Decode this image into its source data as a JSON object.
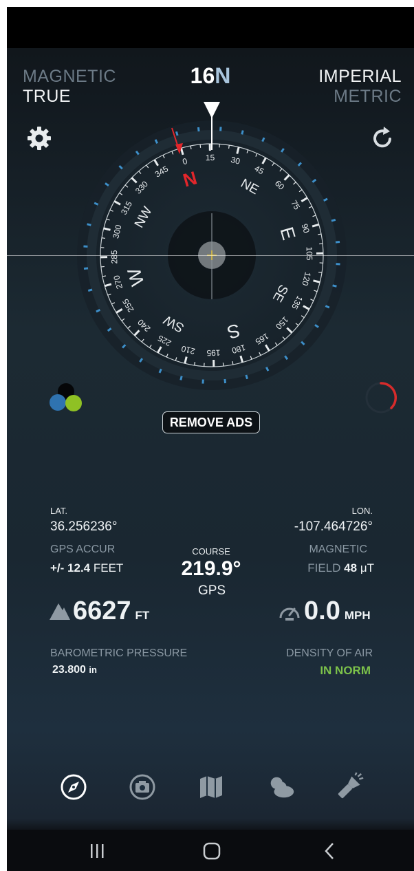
{
  "modes": {
    "north_magnetic": "MAGNETIC",
    "north_true": "TRUE",
    "units_imperial": "IMPERIAL",
    "units_metric": "METRIC"
  },
  "heading": {
    "degrees": "16",
    "direction": "N"
  },
  "compass": {
    "cardinals": [
      "N",
      "NE",
      "E",
      "SE",
      "S",
      "SW",
      "W",
      "NW"
    ],
    "degree_labels": [
      "0",
      "15",
      "30",
      "45",
      "60",
      "75",
      "90",
      "105",
      "120",
      "135",
      "150",
      "165",
      "180",
      "195",
      "210",
      "225",
      "240",
      "255",
      "270",
      "285",
      "300",
      "315",
      "330",
      "345"
    ],
    "rotation_deg": -16
  },
  "ads": {
    "remove_label": "REMOVE ADS"
  },
  "location": {
    "lat_label": "LAT.",
    "lat_value": "36.256236°",
    "lon_label": "LON.",
    "lon_value": "-107.464726°"
  },
  "gps": {
    "accuracy_label": "GPS ACCUR",
    "accuracy_prefix": "+/-",
    "accuracy_value": "12.4",
    "accuracy_unit": "FEET"
  },
  "course": {
    "label": "COURSE",
    "value": "219.9°",
    "source": "GPS"
  },
  "magnetic": {
    "label": "MAGNETIC",
    "field_label": "FIELD",
    "field_value": "48",
    "field_unit": "μT"
  },
  "altitude": {
    "value": "6627",
    "unit": "FT"
  },
  "speed": {
    "value": "0.0",
    "unit": "MPH"
  },
  "pressure": {
    "label": "BAROMETRIC PRESSURE",
    "value": "23.800",
    "unit": "in"
  },
  "air": {
    "label": "DENSITY OF AIR",
    "status": "IN NORM"
  },
  "colors": {
    "accent_red": "#e3262b",
    "tick_blue": "#3d8fc9",
    "status_green": "#7cc24a"
  },
  "tabs": [
    "compass-icon",
    "camera-icon",
    "map-icon",
    "weather-icon",
    "flashlight-icon"
  ],
  "system_nav": [
    "recent-apps-icon",
    "home-icon",
    "back-icon"
  ]
}
